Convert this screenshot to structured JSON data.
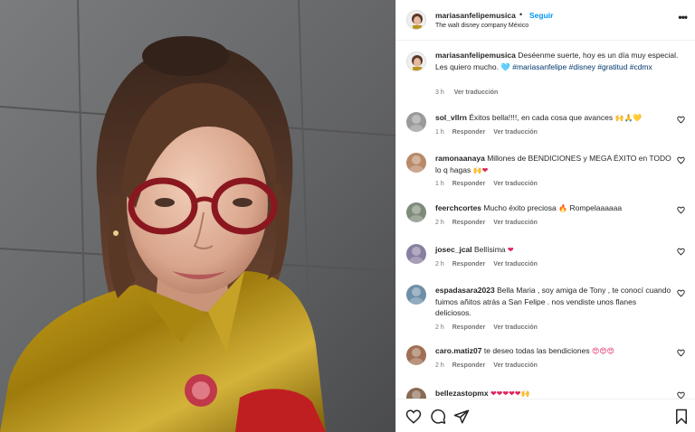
{
  "post": {
    "username": "mariasanfelipemusica",
    "separator": "•",
    "follow_label": "Seguir",
    "location": "The walt disney company México",
    "more_icon": "more-horizontal-icon",
    "caption": {
      "username": "mariasanfelipemusica",
      "text": "Deséenme suerte, hoy es un día muy especial. Les quiero mucho. 🩵",
      "hashtags": "#mariasanfelipe #disney #gratitud #cdmx",
      "time": "3 h",
      "translate": "Ver traducción"
    }
  },
  "comments": [
    {
      "user": "sol_vllrn",
      "text": "Éxitos bella!!!!, en cada cosa que avances",
      "emoji": "🙌🙏💛",
      "time": "1 h",
      "reply": "Responder",
      "translate": "Ver traducción",
      "avatar_color": "#9a9a9a"
    },
    {
      "user": "ramonaanaya",
      "text": "Millones de BENDICIONES y MEGA ÉXITO en TODO lo q hagas",
      "emoji": "🙌❤",
      "time": "1 h",
      "reply": "Responder",
      "translate": "Ver traducción",
      "avatar_color": "#b88a6a"
    },
    {
      "user": "feerchcortes",
      "text": "Mucho éxito preciosa",
      "emoji": "🔥",
      "text2": "Rompelaaaaaa",
      "time": "2 h",
      "reply": "Responder",
      "translate": "Ver traducción",
      "avatar_color": "#7f8b7a"
    },
    {
      "user": "josec_jcal",
      "text": "Bellísima",
      "emoji": "❤",
      "time": "2 h",
      "reply": "Responder",
      "translate": "Ver traducción",
      "avatar_color": "#8a7fa0"
    },
    {
      "user": "espadasara2023",
      "text": "Bella Maria , soy amiga de Tony , te conocí cuando fuimos añitos atrás a San Felipe . nos vendiste unos flanes deliciosos.",
      "emoji": "",
      "time": "2 h",
      "reply": "Responder",
      "translate": "Ver traducción",
      "avatar_color": "#6f8fa8"
    },
    {
      "user": "caro.matiz07",
      "text": "te deseo todas las bendiciones",
      "emoji": "😍😍😍",
      "time": "2 h",
      "reply": "Responder",
      "translate": "Ver traducción",
      "avatar_color": "#a07055"
    },
    {
      "user": "bellezastopmx",
      "text": "",
      "emoji": "❤❤❤❤❤🙌",
      "time": "",
      "reply": "",
      "translate": "",
      "avatar_color": "#8a6a55"
    }
  ],
  "action_icons": [
    "heart-icon",
    "comment-icon",
    "share-icon",
    "bookmark-icon"
  ],
  "colors": {
    "link": "#0095f6",
    "hashtag": "#00376b",
    "meta": "#737373",
    "text": "#262626"
  }
}
